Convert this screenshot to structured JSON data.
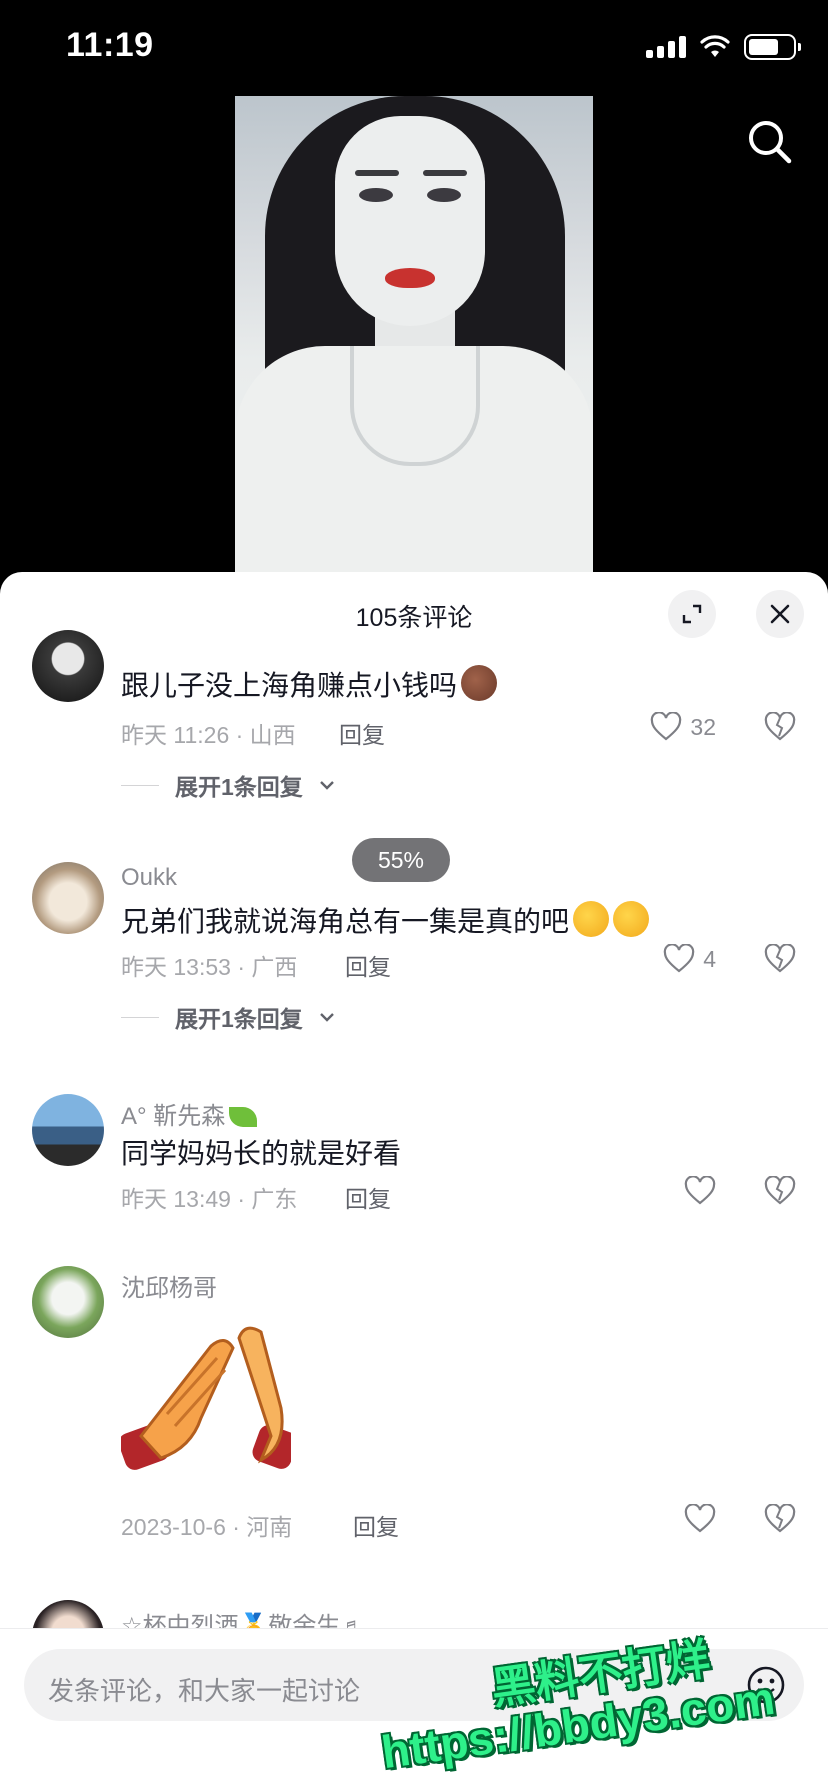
{
  "status_bar": {
    "time": "11:19",
    "battery_level": 0.68
  },
  "video": {
    "search_icon": "search-icon"
  },
  "comments_sheet": {
    "title": "105条评论",
    "expand_icon": "expand-icon",
    "close_icon": "close-icon",
    "progress_badge": "55%",
    "comments": [
      {
        "username": "",
        "text": "跟儿子没上海角赚点小钱吗",
        "time_location": "昨天 11:26 · 山西",
        "reply_label": "回复",
        "likes": "32",
        "expand_replies": "展开1条回复"
      },
      {
        "username": "Oukk",
        "text": "兄弟们我就说海角总有一集是真的吧",
        "time_location": "昨天 13:53 · 广西",
        "reply_label": "回复",
        "likes": "4",
        "expand_replies": "展开1条回复"
      },
      {
        "username": "A° 靳先森",
        "text": "同学妈妈长的就是好看",
        "time_location": "昨天 13:49 · 广东",
        "reply_label": "回复",
        "likes": ""
      },
      {
        "username": "沈邱杨哥",
        "text": "",
        "time_location": "2023-10-6 · 河南",
        "reply_label": "回复",
        "likes": ""
      },
      {
        "username": "☆杯中烈酒🥇敬余生♬"
      }
    ]
  },
  "input": {
    "placeholder": "发条评论，和大家一起讨论"
  },
  "watermark": {
    "line1": "黑料不打烊",
    "line2": "https://bbdy3.com"
  }
}
